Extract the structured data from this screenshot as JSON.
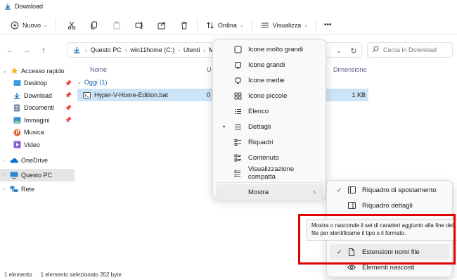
{
  "window": {
    "title": "Download"
  },
  "toolbar": {
    "new_label": "Nuovo",
    "sort_label": "Ordina",
    "view_label": "Visualizza",
    "more_label": "•••"
  },
  "address": {
    "crumbs": [
      "Questo PC",
      "win11home (C:)",
      "Utenti",
      "Miche"
    ],
    "search_placeholder": "Cerca in Download"
  },
  "sidebar": {
    "items": [
      {
        "label": "Accesso rapido",
        "icon": "star-icon"
      },
      {
        "label": "Desktop",
        "icon": "desktop-folder-icon"
      },
      {
        "label": "Download",
        "icon": "download-icon"
      },
      {
        "label": "Documenti",
        "icon": "documents-icon"
      },
      {
        "label": "Immagini",
        "icon": "pictures-icon"
      },
      {
        "label": "Musica",
        "icon": "music-icon"
      },
      {
        "label": "Video",
        "icon": "video-icon"
      },
      {
        "label": "OneDrive",
        "icon": "cloud-icon"
      },
      {
        "label": "Questo PC",
        "icon": "pc-icon"
      },
      {
        "label": "Rete",
        "icon": "network-icon"
      }
    ]
  },
  "content": {
    "col_name": "Nome",
    "col_u": "U",
    "col_size": "Dimensione",
    "group": "Oggi (1)",
    "file": {
      "name": "Hyper-V-Home-Edition.bat",
      "date_frag": "0",
      "size": "1 KB"
    }
  },
  "view_menu": {
    "items": [
      "Icone molto grandi",
      "Icone grandi",
      "Icone medie",
      "Icone piccole",
      "Elenco",
      "Dettagli",
      "Riquadri",
      "Contenuto",
      "Visualizzazione compatta"
    ],
    "show_label": "Mostra",
    "show_arrow": "›",
    "bullet": "•"
  },
  "show_menu": {
    "items": [
      "Riquadro di spostamento",
      "Riquadro dettagli",
      "Estensioni nomi file",
      "Elementi nascosti"
    ],
    "check": "✓"
  },
  "tooltip": {
    "text": "Mostra o nasconde il set di caratteri aggiunto alla fine dei file per identificarne il tipo o il formato."
  },
  "status": {
    "count": "1 elemento",
    "selected": "1 elemento selezionato  352 byte"
  },
  "colors": {
    "accent": "#0067c0",
    "highlight_box": "#e00000",
    "selection": "#cce4f7"
  }
}
